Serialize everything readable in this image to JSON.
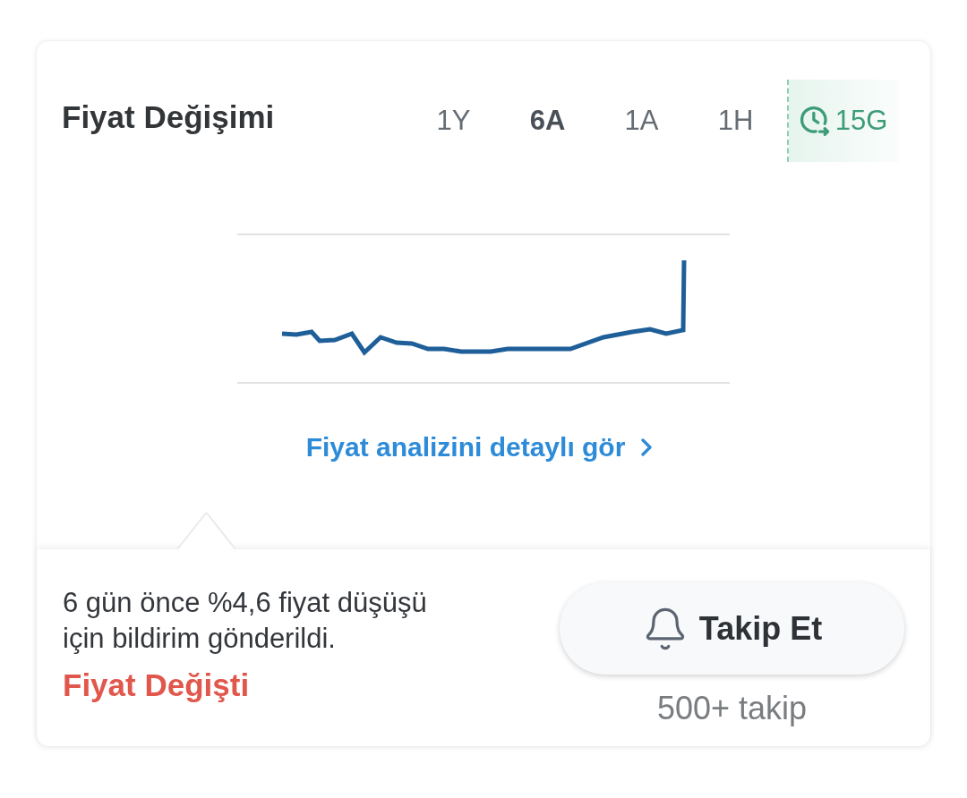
{
  "header": {
    "title": "Fiyat Değişimi",
    "tabs": [
      {
        "label": "1Y",
        "selected": false,
        "kind": "period"
      },
      {
        "label": "6A",
        "selected": true,
        "kind": "period"
      },
      {
        "label": "1A",
        "selected": false,
        "kind": "period"
      },
      {
        "label": "1H",
        "selected": false,
        "kind": "period"
      },
      {
        "label": "15G",
        "selected": false,
        "kind": "recent"
      }
    ]
  },
  "chart": {
    "link": "Fiyat analizini detaylı gör"
  },
  "notification": {
    "message": "6 gün önce %4,6 fiyat düşüşü için bildirim gönderildi.",
    "status": "Fiyat Değişti"
  },
  "follow": {
    "button": "Takip Et",
    "count": "500+ takip"
  }
}
